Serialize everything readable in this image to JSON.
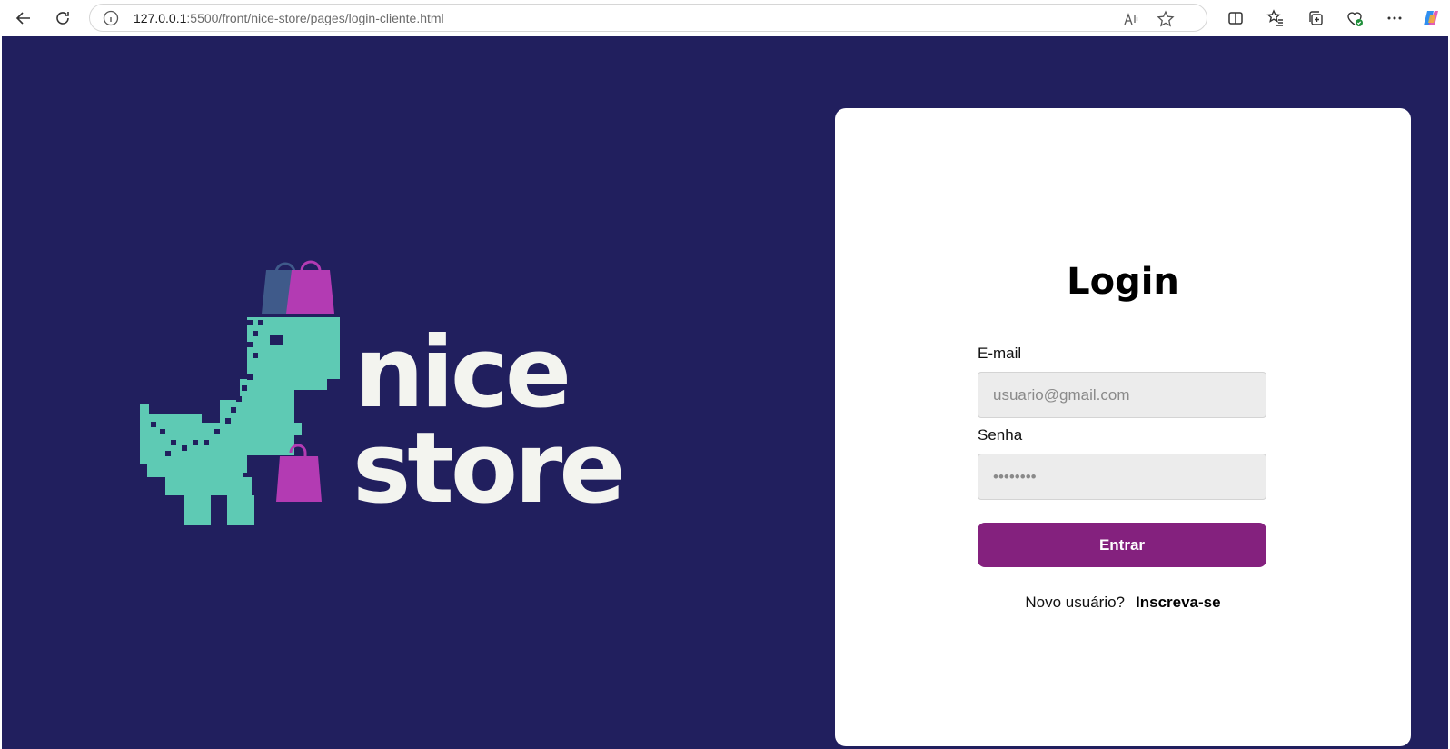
{
  "browser": {
    "url_host": "127.0.0.1",
    "url_rest": ":5500/front/nice-store/pages/login-cliente.html",
    "icons": [
      "back-icon",
      "refresh-icon",
      "info-icon",
      "read-aloud-icon",
      "favorite-star-icon",
      "split-screen-icon",
      "favorites-icon",
      "collections-icon",
      "browser-essentials-icon",
      "more-icon",
      "copilot-icon"
    ]
  },
  "brand": {
    "line1": "nice",
    "line2": "store",
    "colors": {
      "background": "#211f5e",
      "dino": "#5ecab4",
      "bag_pink": "#b33bb3",
      "bag_blue": "#3f5a8a",
      "text": "#f3f4ef"
    }
  },
  "login": {
    "title": "Login",
    "email_label": "E-mail",
    "email_placeholder": "usuario@gmail.com",
    "password_label": "Senha",
    "password_placeholder": "••••••••",
    "submit_label": "Entrar",
    "new_user_text": "Novo usuário?",
    "signup_link": "Inscreva-se",
    "accent": "#84217e"
  }
}
